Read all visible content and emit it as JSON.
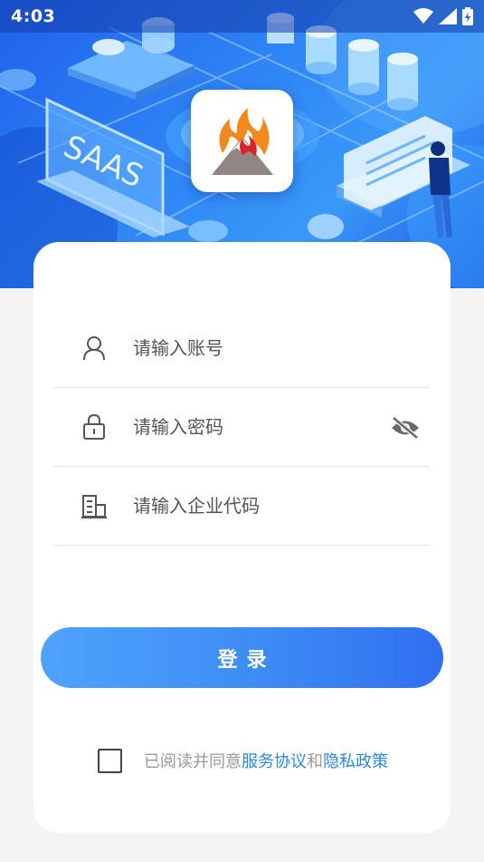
{
  "status_bar": {
    "time": "4:03",
    "icons": [
      "wifi-icon",
      "cell-signal-icon",
      "battery-charging-icon"
    ]
  },
  "banner": {
    "illustration_text": "SAAS"
  },
  "logo": {
    "icon": "flame-mountain-logo"
  },
  "form": {
    "account": {
      "placeholder": "请输入账号",
      "value": "",
      "icon": "user-icon"
    },
    "password": {
      "placeholder": "请输入密码",
      "value": "",
      "icon": "lock-icon",
      "toggle_icon": "eye-off-icon"
    },
    "company": {
      "placeholder": "请输入企业代码",
      "value": "",
      "icon": "building-icon"
    }
  },
  "login_button": {
    "label": "登录"
  },
  "agreement": {
    "checked": false,
    "prefix": "已阅读并同意",
    "terms_link": "服务协议",
    "joiner": "和",
    "privacy_link": "隐私政策"
  },
  "colors": {
    "accent": "#3d8bf6",
    "link": "#2a86e8",
    "banner": "#2f86f5"
  }
}
